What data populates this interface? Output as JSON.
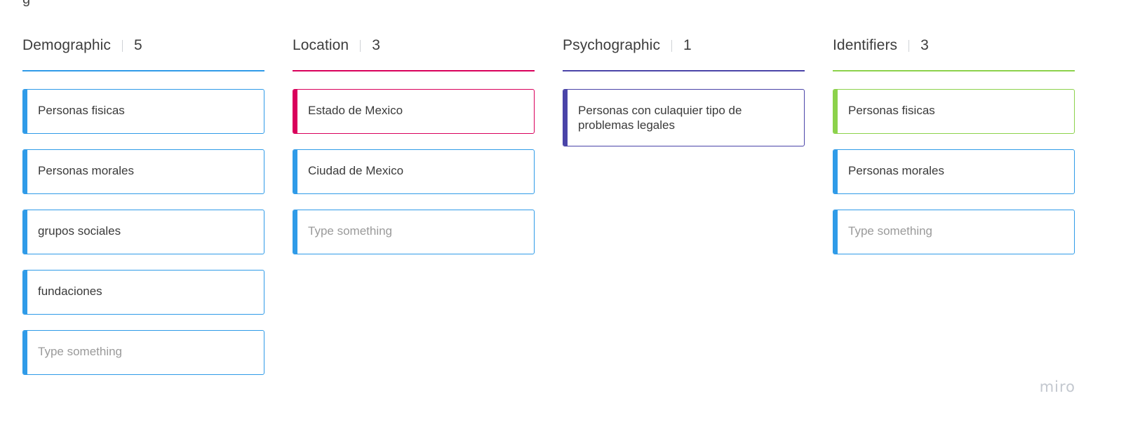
{
  "top_clip_text": "g",
  "columns": [
    {
      "title": "Demographic",
      "count": "5",
      "color": "#2f9be8",
      "cards": [
        {
          "text": "Personas fisicas",
          "placeholder": false,
          "color": "#2f9be8"
        },
        {
          "text": "Personas morales",
          "placeholder": false,
          "color": "#2f9be8"
        },
        {
          "text": "grupos sociales",
          "placeholder": false,
          "color": "#2f9be8"
        },
        {
          "text": "fundaciones",
          "placeholder": false,
          "color": "#2f9be8"
        },
        {
          "text": "Type something",
          "placeholder": true,
          "color": "#2f9be8"
        }
      ]
    },
    {
      "title": "Location",
      "count": "3",
      "color": "#d9005b",
      "cards": [
        {
          "text": "Estado de Mexico",
          "placeholder": false,
          "color": "#d9005b"
        },
        {
          "text": "Ciudad de Mexico",
          "placeholder": false,
          "color": "#2f9be8"
        },
        {
          "text": "Type something",
          "placeholder": true,
          "color": "#2f9be8"
        }
      ]
    },
    {
      "title": "Psychographic",
      "count": "1",
      "color": "#4a44a8",
      "cards": [
        {
          "text": "Personas con culaquier tipo de problemas legales",
          "placeholder": false,
          "color": "#4a44a8"
        }
      ]
    },
    {
      "title": "Identifiers",
      "count": "3",
      "color": "#8cd24b",
      "cards": [
        {
          "text": "Personas fisicas",
          "placeholder": false,
          "color": "#8cd24b"
        },
        {
          "text": "Personas morales",
          "placeholder": false,
          "color": "#2f9be8"
        },
        {
          "text": "Type something",
          "placeholder": true,
          "color": "#2f9be8"
        }
      ]
    }
  ],
  "watermark": "miro"
}
